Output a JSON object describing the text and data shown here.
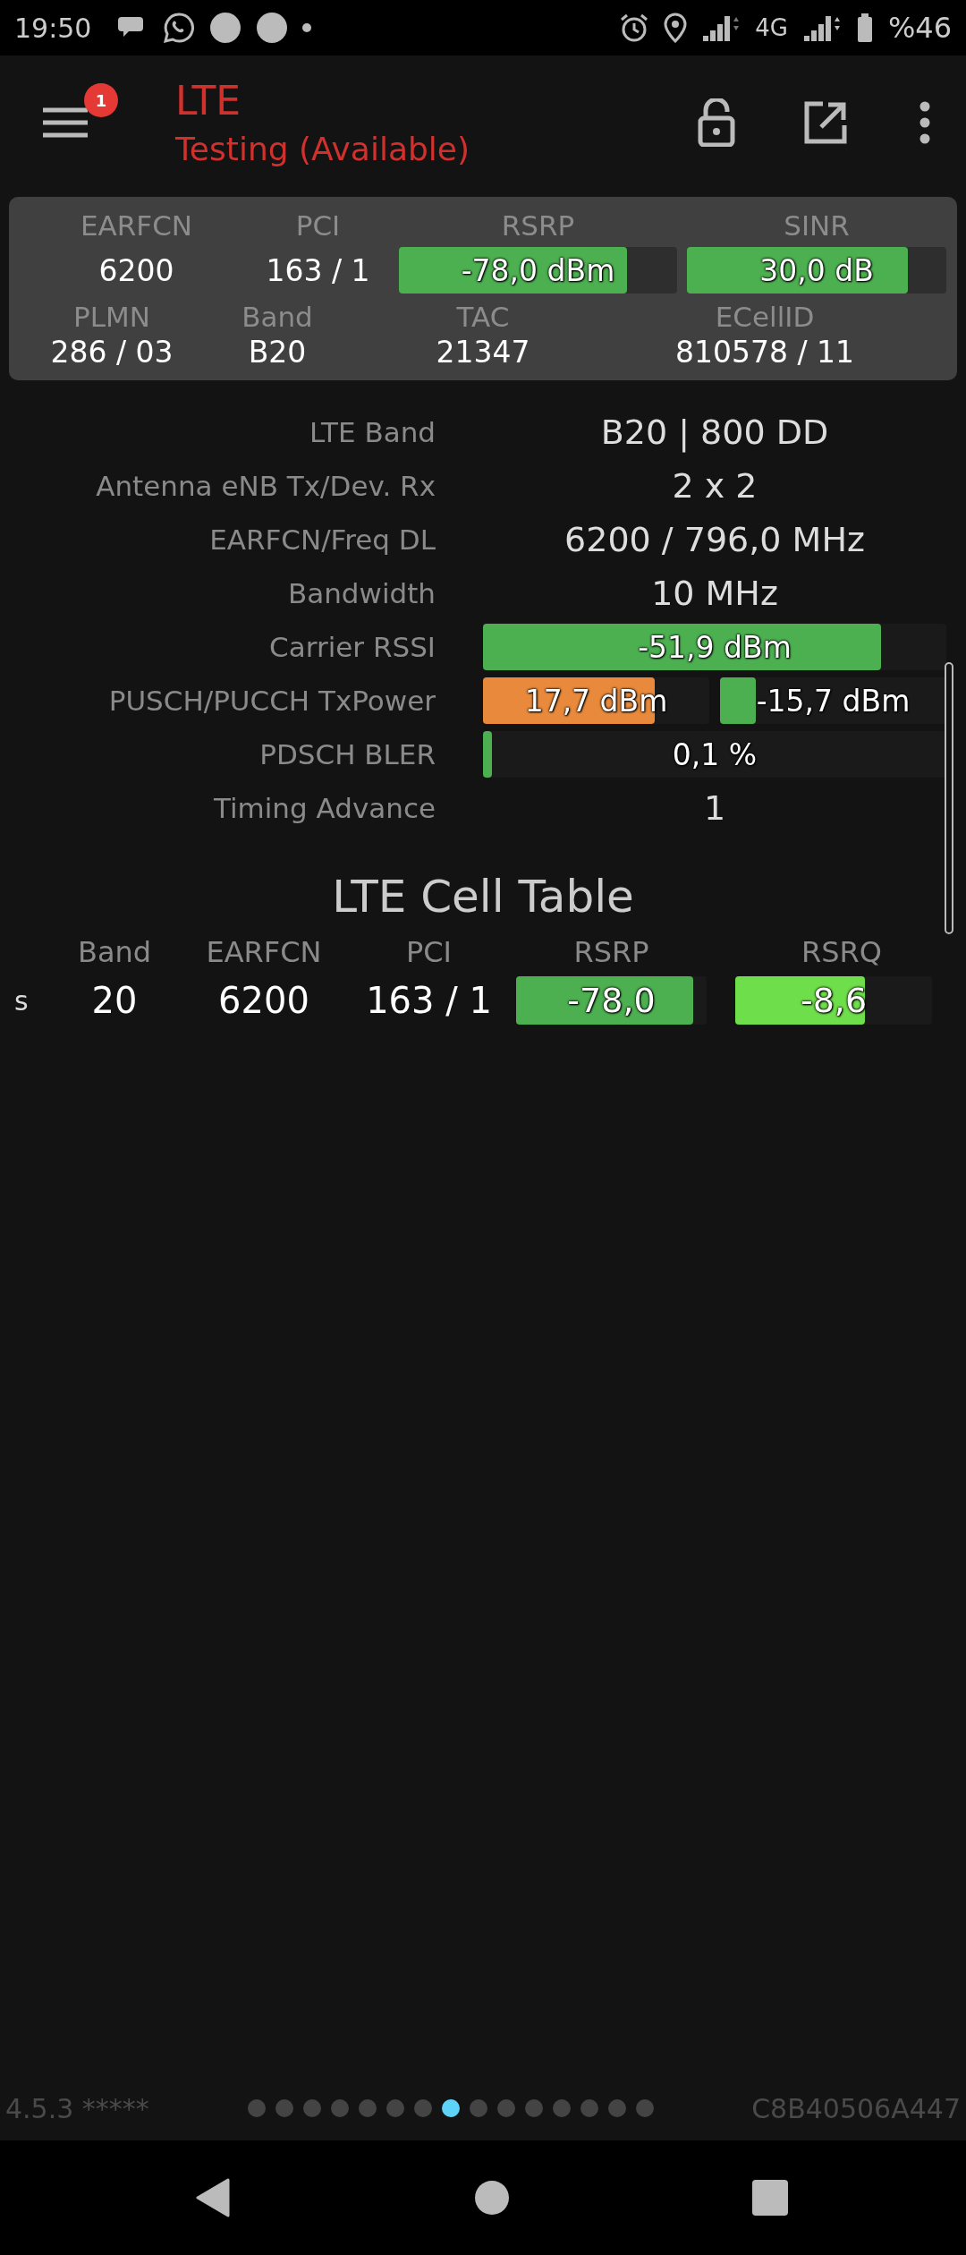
{
  "status_bar": {
    "time": "19:50",
    "network": "4G",
    "battery": "%46"
  },
  "header": {
    "badge": "1",
    "title": "LTE",
    "subtitle": "Testing (Available)"
  },
  "summary": {
    "row1": [
      {
        "label": "EARFCN",
        "kind": "text",
        "value": "6200"
      },
      {
        "label": "PCI",
        "kind": "text",
        "value": "163 / 1"
      },
      {
        "label": "RSRP",
        "kind": "bar",
        "reading": "-78,0 dBm",
        "level": 0.82,
        "color": "#4caf50"
      },
      {
        "label": "SINR",
        "kind": "bar",
        "reading": "30,0 dB",
        "level": 0.85,
        "color": "#4caf50"
      }
    ],
    "row2": [
      {
        "label": "PLMN",
        "value": "286 / 03"
      },
      {
        "label": "Band",
        "value": "B20"
      },
      {
        "label": "TAC",
        "value": "21347"
      },
      {
        "label": "ECellID",
        "value": "810578 / 11"
      }
    ]
  },
  "details": [
    {
      "label": "LTE Band",
      "kind": "text",
      "value": "B20 | 800 DD"
    },
    {
      "label": "Antenna eNB Tx/Dev. Rx",
      "kind": "text",
      "value": "2 x 2"
    },
    {
      "label": "EARFCN/Freq DL",
      "kind": "text",
      "value": "6200 / 796,0 MHz"
    },
    {
      "label": "Bandwidth",
      "kind": "text",
      "value": "10 MHz"
    },
    {
      "label": "Carrier RSSI",
      "kind": "bar",
      "bars": [
        {
          "reading": "-51,9 dBm",
          "level": 0.86,
          "color": "#4caf50"
        }
      ]
    },
    {
      "label": "PUSCH/PUCCH TxPower",
      "kind": "bar",
      "bars": [
        {
          "reading": "17,7 dBm",
          "level": 0.76,
          "color": "#e8893b"
        },
        {
          "reading": "-15,7 dBm",
          "level": 0.16,
          "color": "#4caf50"
        }
      ]
    },
    {
      "label": "PDSCH BLER",
      "kind": "bar",
      "bars": [
        {
          "reading": "0,1 %",
          "level": 0.02,
          "color": "#4caf50"
        }
      ]
    },
    {
      "label": "Timing Advance",
      "kind": "text",
      "value": "1"
    }
  ],
  "cell_table": {
    "title": "LTE Cell Table",
    "columns": [
      "Band",
      "EARFCN",
      "PCI",
      "RSRP",
      "RSRQ"
    ],
    "rows": [
      {
        "type": "s",
        "band": "20",
        "earfcn": "6200",
        "pci": "163 / 1",
        "rsrp": {
          "reading": "-78,0",
          "level": 0.93,
          "color": "#4caf50"
        },
        "rsrq": {
          "reading": "-8,6",
          "level": 0.66,
          "color": "#6ede4a"
        }
      }
    ]
  },
  "footer": {
    "version": "4.5.3 *****",
    "device_id": "C8B40506A447",
    "pages": [
      {
        "selected": false
      },
      {
        "selected": false
      },
      {
        "selected": false
      },
      {
        "selected": false
      },
      {
        "selected": false
      },
      {
        "selected": false
      },
      {
        "selected": false
      },
      {
        "selected": true
      },
      {
        "selected": false
      },
      {
        "selected": false
      },
      {
        "selected": false
      },
      {
        "selected": false
      },
      {
        "selected": false
      },
      {
        "selected": false
      },
      {
        "selected": false
      }
    ]
  }
}
